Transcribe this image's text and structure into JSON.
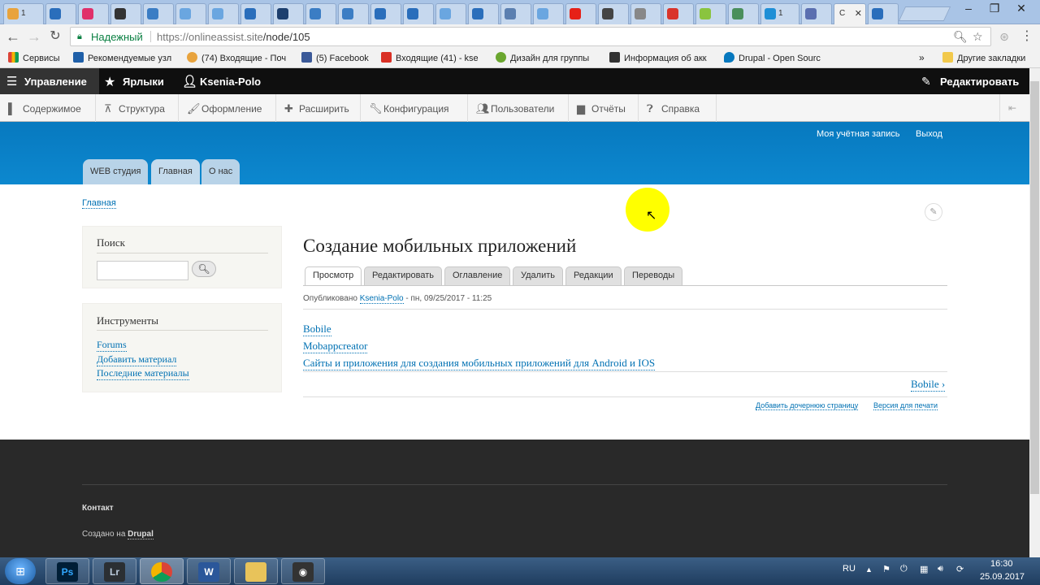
{
  "browser": {
    "active_tab": {
      "title": "С"
    },
    "secure_label": "Надежный",
    "url_scheme_host": "https://onlineassist.site",
    "url_path": "/node/105",
    "bookmarks": [
      "Сервисы",
      "Рекомендуемые узл",
      "(74) Входящие - Поч",
      "(5) Facebook",
      "Входящие (41) - kse",
      "Дизайн для группы",
      "Информация об акк",
      "Drupal - Open Sourc",
      "Другие закладки"
    ],
    "more_bookmarks": "»"
  },
  "admin_toolbar": {
    "manage": "Управление",
    "shortcuts": "Ярлыки",
    "user": "Ksenia-Polo",
    "edit": "Редактировать"
  },
  "admin_tray": [
    "Содержимое",
    "Структура",
    "Оформление",
    "Расширить",
    "Конфигурация",
    "Пользователи",
    "Отчёты",
    "Справка"
  ],
  "header": {
    "account": "Моя учётная запись",
    "logout": "Выход",
    "primary_tabs": [
      "WEB студия",
      "Главная",
      "О нас"
    ]
  },
  "breadcrumb": "Главная",
  "sidebar": {
    "search_title": "Поиск",
    "tools_title": "Инструменты",
    "tools": [
      "Forums",
      "Добавить материал",
      "Последние материалы"
    ]
  },
  "node": {
    "title": "Создание мобильных приложений",
    "tabs": [
      "Просмотр",
      "Редактировать",
      "Оглавление",
      "Удалить",
      "Редакции",
      "Переводы"
    ],
    "meta_prefix": "Опубликовано",
    "meta_author": "Ksenia-Polo",
    "meta_date": "- пн, 09/25/2017 - 11:25",
    "book_links": [
      "Bobile",
      "Mobappcreator",
      "Сайты и приложения для создания мобильных приложений для Android и IOS"
    ],
    "next_link": "Bobile ›",
    "add_child": "Добавить дочернюю страницу",
    "print": "Версия для печати"
  },
  "footer": {
    "contact": "Контакт",
    "powered_prefix": "Создано на",
    "powered_link": "Drupal"
  },
  "taskbar": {
    "lang": "RU",
    "time": "16:30",
    "date": "25.09.2017"
  }
}
